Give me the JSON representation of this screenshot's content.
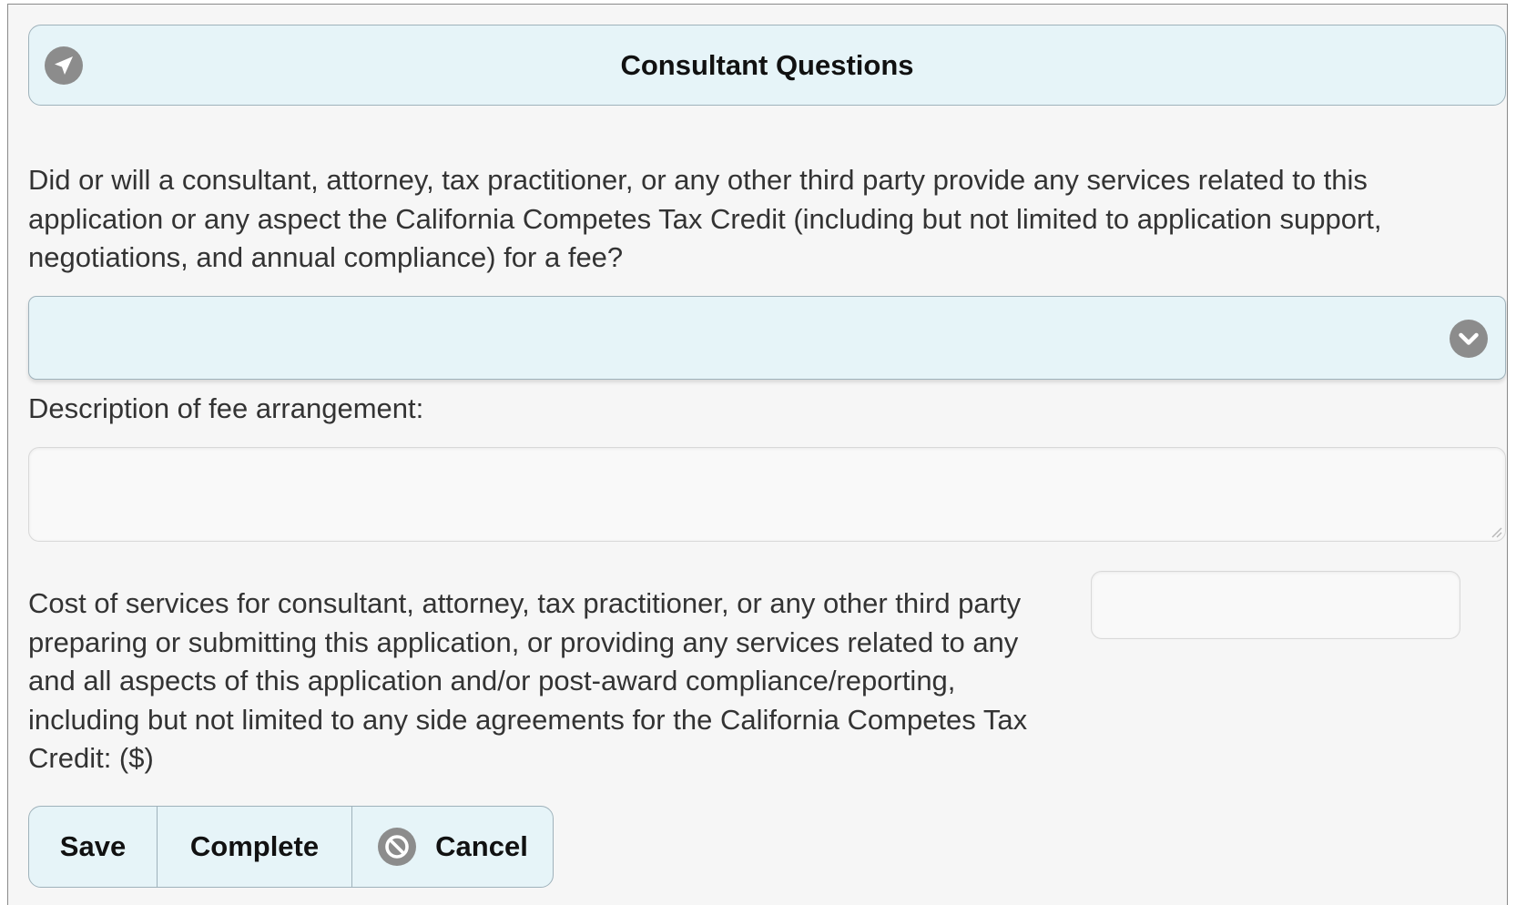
{
  "header": {
    "title": "Consultant Questions",
    "icon": "navigation-arrow-icon"
  },
  "question": {
    "text": "Did or will a consultant, attorney, tax practitioner, or any other third party provide any services related to this application or any aspect the California Competes Tax Credit (including but not limited to application support, negotiations, and annual compliance) for a fee?",
    "selected_value": "",
    "icon": "chevron-down-icon"
  },
  "fee_description": {
    "label": "Description of fee arrangement:",
    "value": ""
  },
  "cost": {
    "label": "Cost of services for consultant, attorney, tax practitioner, or any other third party preparing or submitting this application, or providing any services related to any and all aspects of this application and/or post-award compliance/reporting, including but not limited to any side agreements for the California Competes Tax Credit: ($)",
    "value": ""
  },
  "buttons": {
    "save": "Save",
    "complete": "Complete",
    "cancel": "Cancel",
    "cancel_icon": "cancel-circle-icon"
  },
  "colors": {
    "bar_background": "#e6f4f8",
    "bar_border": "#9fb2bb",
    "icon_gray": "#8c8c8c",
    "page_background": "#f6f6f6"
  }
}
